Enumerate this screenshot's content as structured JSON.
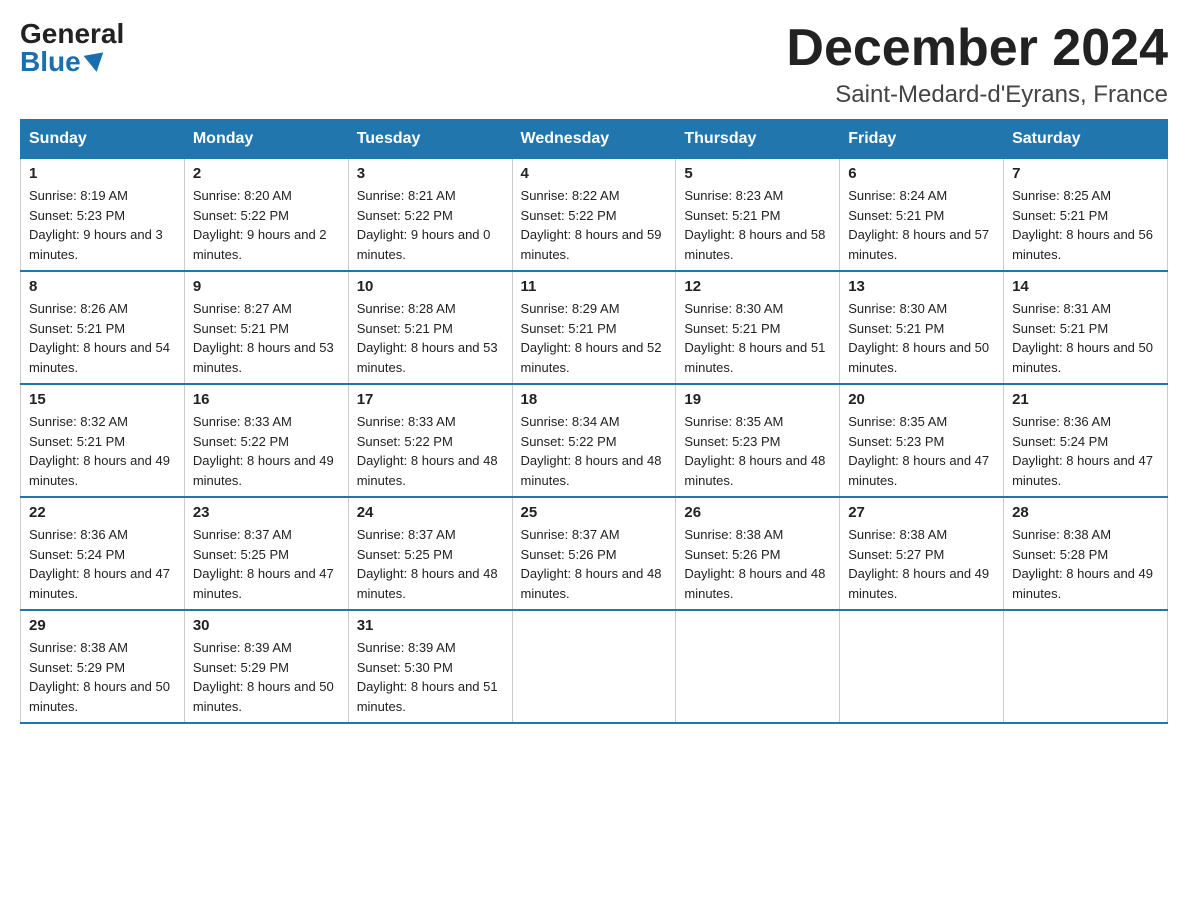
{
  "header": {
    "logo_general": "General",
    "logo_blue": "Blue",
    "month_title": "December 2024",
    "location": "Saint-Medard-d'Eyrans, France"
  },
  "weekdays": [
    "Sunday",
    "Monday",
    "Tuesday",
    "Wednesday",
    "Thursday",
    "Friday",
    "Saturday"
  ],
  "weeks": [
    [
      {
        "day": "1",
        "sunrise": "8:19 AM",
        "sunset": "5:23 PM",
        "daylight": "9 hours and 3 minutes."
      },
      {
        "day": "2",
        "sunrise": "8:20 AM",
        "sunset": "5:22 PM",
        "daylight": "9 hours and 2 minutes."
      },
      {
        "day": "3",
        "sunrise": "8:21 AM",
        "sunset": "5:22 PM",
        "daylight": "9 hours and 0 minutes."
      },
      {
        "day": "4",
        "sunrise": "8:22 AM",
        "sunset": "5:22 PM",
        "daylight": "8 hours and 59 minutes."
      },
      {
        "day": "5",
        "sunrise": "8:23 AM",
        "sunset": "5:21 PM",
        "daylight": "8 hours and 58 minutes."
      },
      {
        "day": "6",
        "sunrise": "8:24 AM",
        "sunset": "5:21 PM",
        "daylight": "8 hours and 57 minutes."
      },
      {
        "day": "7",
        "sunrise": "8:25 AM",
        "sunset": "5:21 PM",
        "daylight": "8 hours and 56 minutes."
      }
    ],
    [
      {
        "day": "8",
        "sunrise": "8:26 AM",
        "sunset": "5:21 PM",
        "daylight": "8 hours and 54 minutes."
      },
      {
        "day": "9",
        "sunrise": "8:27 AM",
        "sunset": "5:21 PM",
        "daylight": "8 hours and 53 minutes."
      },
      {
        "day": "10",
        "sunrise": "8:28 AM",
        "sunset": "5:21 PM",
        "daylight": "8 hours and 53 minutes."
      },
      {
        "day": "11",
        "sunrise": "8:29 AM",
        "sunset": "5:21 PM",
        "daylight": "8 hours and 52 minutes."
      },
      {
        "day": "12",
        "sunrise": "8:30 AM",
        "sunset": "5:21 PM",
        "daylight": "8 hours and 51 minutes."
      },
      {
        "day": "13",
        "sunrise": "8:30 AM",
        "sunset": "5:21 PM",
        "daylight": "8 hours and 50 minutes."
      },
      {
        "day": "14",
        "sunrise": "8:31 AM",
        "sunset": "5:21 PM",
        "daylight": "8 hours and 50 minutes."
      }
    ],
    [
      {
        "day": "15",
        "sunrise": "8:32 AM",
        "sunset": "5:21 PM",
        "daylight": "8 hours and 49 minutes."
      },
      {
        "day": "16",
        "sunrise": "8:33 AM",
        "sunset": "5:22 PM",
        "daylight": "8 hours and 49 minutes."
      },
      {
        "day": "17",
        "sunrise": "8:33 AM",
        "sunset": "5:22 PM",
        "daylight": "8 hours and 48 minutes."
      },
      {
        "day": "18",
        "sunrise": "8:34 AM",
        "sunset": "5:22 PM",
        "daylight": "8 hours and 48 minutes."
      },
      {
        "day": "19",
        "sunrise": "8:35 AM",
        "sunset": "5:23 PM",
        "daylight": "8 hours and 48 minutes."
      },
      {
        "day": "20",
        "sunrise": "8:35 AM",
        "sunset": "5:23 PM",
        "daylight": "8 hours and 47 minutes."
      },
      {
        "day": "21",
        "sunrise": "8:36 AM",
        "sunset": "5:24 PM",
        "daylight": "8 hours and 47 minutes."
      }
    ],
    [
      {
        "day": "22",
        "sunrise": "8:36 AM",
        "sunset": "5:24 PM",
        "daylight": "8 hours and 47 minutes."
      },
      {
        "day": "23",
        "sunrise": "8:37 AM",
        "sunset": "5:25 PM",
        "daylight": "8 hours and 47 minutes."
      },
      {
        "day": "24",
        "sunrise": "8:37 AM",
        "sunset": "5:25 PM",
        "daylight": "8 hours and 48 minutes."
      },
      {
        "day": "25",
        "sunrise": "8:37 AM",
        "sunset": "5:26 PM",
        "daylight": "8 hours and 48 minutes."
      },
      {
        "day": "26",
        "sunrise": "8:38 AM",
        "sunset": "5:26 PM",
        "daylight": "8 hours and 48 minutes."
      },
      {
        "day": "27",
        "sunrise": "8:38 AM",
        "sunset": "5:27 PM",
        "daylight": "8 hours and 49 minutes."
      },
      {
        "day": "28",
        "sunrise": "8:38 AM",
        "sunset": "5:28 PM",
        "daylight": "8 hours and 49 minutes."
      }
    ],
    [
      {
        "day": "29",
        "sunrise": "8:38 AM",
        "sunset": "5:29 PM",
        "daylight": "8 hours and 50 minutes."
      },
      {
        "day": "30",
        "sunrise": "8:39 AM",
        "sunset": "5:29 PM",
        "daylight": "8 hours and 50 minutes."
      },
      {
        "day": "31",
        "sunrise": "8:39 AM",
        "sunset": "5:30 PM",
        "daylight": "8 hours and 51 minutes."
      },
      null,
      null,
      null,
      null
    ]
  ],
  "labels": {
    "sunrise": "Sunrise:",
    "sunset": "Sunset:",
    "daylight": "Daylight:"
  }
}
